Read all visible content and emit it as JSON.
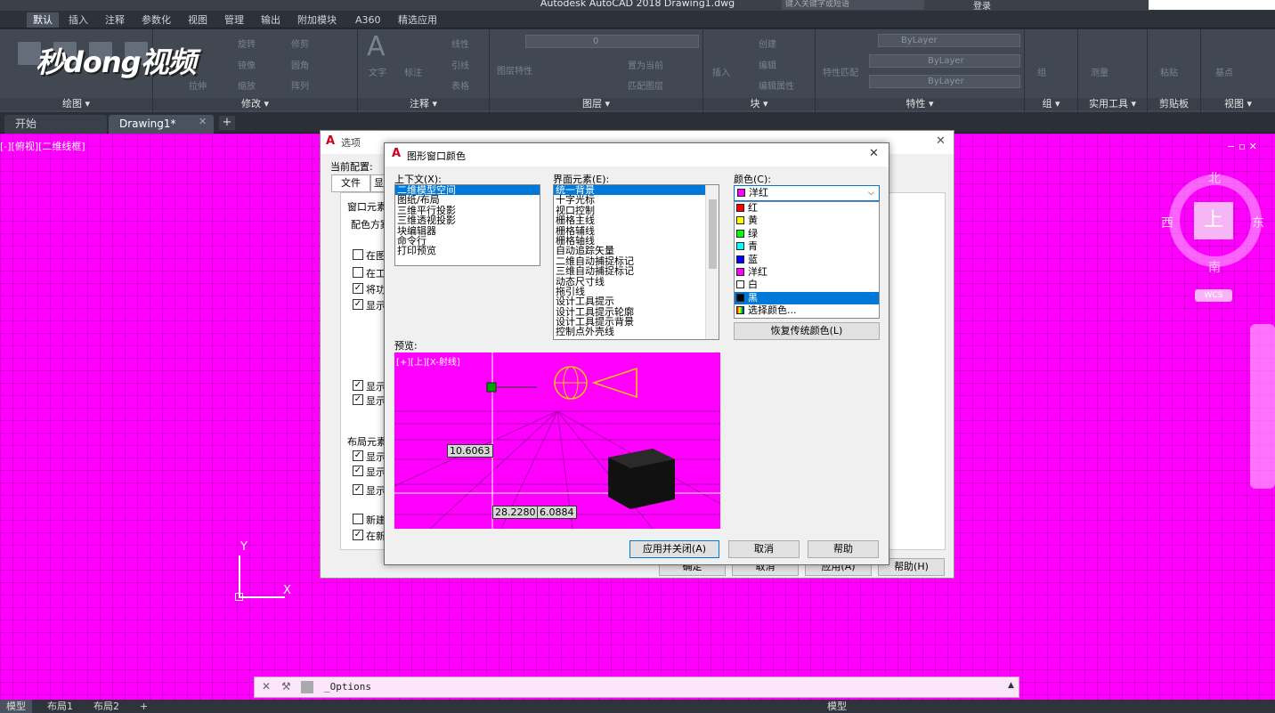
{
  "app": {
    "title": "Autodesk AutoCAD 2018    Drawing1.dwg",
    "search_placeholder": "键入关键字或短语",
    "login": "登录"
  },
  "watermark": "秒dong视频",
  "ribbon": {
    "tabs": [
      "默认",
      "插入",
      "注释",
      "参数化",
      "视图",
      "管理",
      "输出",
      "附加模块",
      "A360",
      "精选应用"
    ],
    "panels": [
      {
        "label": "绘图 ▾",
        "items": [
          "直线",
          "多段线",
          "圆",
          "圆弧"
        ]
      },
      {
        "label": "修改 ▾",
        "items": [
          "旋转",
          "修剪",
          "镜像",
          "圆角",
          "拉伸",
          "缩放",
          "阵列"
        ]
      },
      {
        "label": "注释 ▾",
        "items": [
          "文字",
          "标注",
          "线性",
          "引线",
          "表格"
        ]
      },
      {
        "label": "图层 ▾",
        "items": [
          "图层特性",
          "置为当前",
          "匹配图层"
        ]
      },
      {
        "label": "块 ▾",
        "items": [
          "插入",
          "创建",
          "编辑",
          "编辑属性"
        ]
      },
      {
        "label": "特性 ▾",
        "items": [
          "特性匹配",
          "ByLayer",
          "ByLayer",
          "ByLayer"
        ]
      },
      {
        "label": "组 ▾",
        "items": [
          "组"
        ]
      },
      {
        "label": "实用工具 ▾",
        "items": [
          "测量"
        ]
      },
      {
        "label": "剪贴板",
        "items": [
          "粘贴"
        ]
      },
      {
        "label": "视图 ▾",
        "items": [
          "基点"
        ]
      }
    ],
    "layer_value": "0"
  },
  "file_tabs": [
    "开始",
    "Drawing1*"
  ],
  "viewport_label": "[-][俯视][二维线框]",
  "viewcube": {
    "top": "上",
    "north": "北",
    "south": "南",
    "east": "东",
    "west": "西",
    "wcs": "WCS"
  },
  "ucs": {
    "x": "X",
    "y": "Y"
  },
  "options_dialog": {
    "title": "选项",
    "current_profile": "当前配置:",
    "tabs": [
      "文件",
      "显"
    ],
    "section_window": "窗口元素",
    "scheme": "配色方案",
    "checks": [
      {
        "label": "在图",
        "checked": false
      },
      {
        "label": "在工",
        "checked": false
      },
      {
        "label": "将功",
        "checked": true
      },
      {
        "label": "显示",
        "checked": true
      },
      {
        "label": "显示",
        "checked": true
      },
      {
        "label": "显示",
        "checked": true
      }
    ],
    "section_layout": "布局元素",
    "layout_checks": [
      {
        "label": "显示",
        "checked": true
      },
      {
        "label": "显示",
        "checked": true
      },
      {
        "label": "显示",
        "checked": true
      },
      {
        "label": "新建",
        "checked": false
      },
      {
        "label": "在新",
        "checked": true
      }
    ],
    "buttons": [
      "确定",
      "取消",
      "应用(A)",
      "帮助(H)"
    ]
  },
  "color_dialog": {
    "title": "图形窗口颜色",
    "context_label": "上下文(X):",
    "contexts": [
      "二维模型空间",
      "图纸/布局",
      "三维平行投影",
      "三维透视投影",
      "块编辑器",
      "命令行",
      "打印预览"
    ],
    "elements_label": "界面元素(E):",
    "elements": [
      "统一背景",
      "十字光标",
      "视口控制",
      "栅格主线",
      "栅格辅线",
      "栅格轴线",
      "自动追踪矢量",
      "二维自动捕捉标记",
      "三维自动捕捉标记",
      "动态尺寸线",
      "拖引线",
      "设计工具提示",
      "设计工具提示轮廓",
      "设计工具提示背景",
      "控制点外壳线"
    ],
    "color_label": "颜色(C):",
    "color_selected": "洋红",
    "colors": [
      {
        "name": "红",
        "hex": "#ff0000"
      },
      {
        "name": "黄",
        "hex": "#ffff00"
      },
      {
        "name": "绿",
        "hex": "#00ff00"
      },
      {
        "name": "青",
        "hex": "#00ffff"
      },
      {
        "name": "蓝",
        "hex": "#0000ff"
      },
      {
        "name": "洋红",
        "hex": "#ff00ff"
      },
      {
        "name": "白",
        "hex": "#ffffff"
      },
      {
        "name": "黑",
        "hex": "#000000"
      },
      {
        "name": "选择颜色...",
        "hex": "#7f7f7f"
      }
    ],
    "restore_button": "恢复传统颜色(L)",
    "preview_label": "预览:",
    "preview_viewport": "[+][上][X-射线]",
    "preview_values": [
      "10.6063",
      "28.2280",
      "6.0884"
    ],
    "buttons": [
      "应用并关闭(A)",
      "取消",
      "帮助"
    ]
  },
  "command_line": {
    "text": "_Options"
  },
  "status": {
    "tabs": [
      "模型",
      "布局1",
      "布局2"
    ],
    "right": "模型"
  },
  "accent": "#0078d7",
  "background_color": "#ff00ff"
}
